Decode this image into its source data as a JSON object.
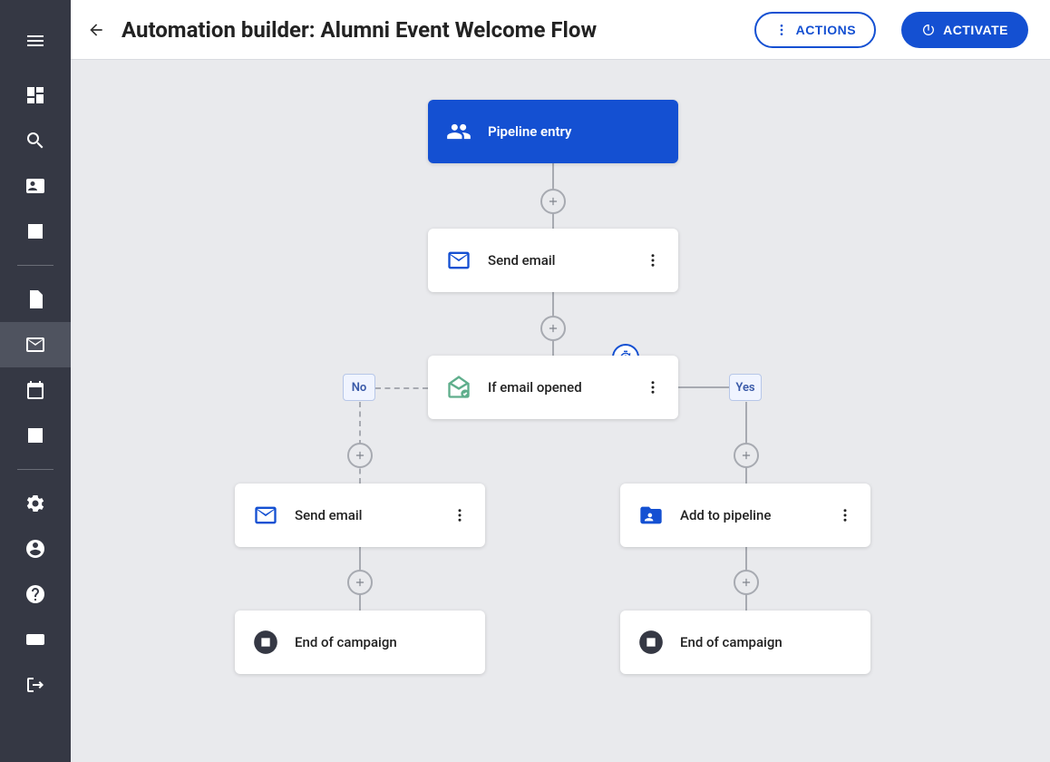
{
  "header": {
    "title": "Automation builder: Alumni Event Welcome Flow",
    "actions_label": "ACTIONS",
    "activate_label": "ACTIVATE"
  },
  "nodes": {
    "entry": {
      "label": "Pipeline entry"
    },
    "send1": {
      "label": "Send email"
    },
    "condition": {
      "label": "If email opened"
    },
    "no_send": {
      "label": "Send email"
    },
    "yes_pipeline": {
      "label": "Add to pipeline"
    },
    "no_end": {
      "label": "End of campaign"
    },
    "yes_end": {
      "label": "End of campaign"
    }
  },
  "branches": {
    "no": "No",
    "yes": "Yes"
  }
}
